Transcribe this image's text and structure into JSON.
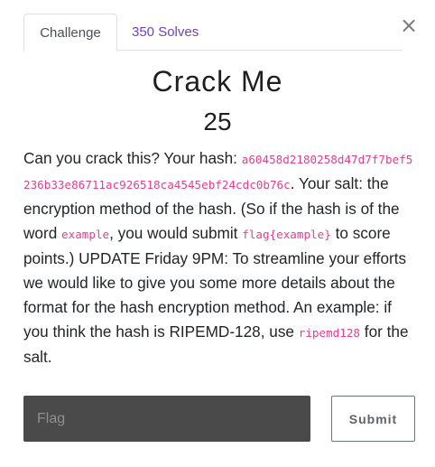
{
  "modal": {
    "close_symbol": "×"
  },
  "tabs": [
    {
      "label": "Challenge",
      "active": true
    },
    {
      "label": "350 Solves",
      "active": false
    }
  ],
  "challenge": {
    "title": "Crack Me",
    "points": "25",
    "description": {
      "part1": "Can you crack this? Your hash: ",
      "hash": "a60458d2180258d47d7f7bef5236b33e86711ac926518ca4545ebf24cdc0b76c",
      "part2": ". Your salt: the encryption method of the hash. (So if the hash is of the word ",
      "code_example": "example",
      "part3": ", you would submit ",
      "code_flag": "flag{example}",
      "part4": " to score points.) UPDATE Friday 9PM: To streamline your efforts we would like to give you some more details about the format for the hash encryption method. An example: if you think the hash is RIPEMD-128, use ",
      "code_salt": "ripemd128",
      "part5": " for the salt."
    }
  },
  "form": {
    "flag_placeholder": "Flag",
    "submit_label": "Submit"
  },
  "colors": {
    "accent": "#6f42c1",
    "code": "#e83e8c",
    "input_bg": "#4a4a4a"
  }
}
